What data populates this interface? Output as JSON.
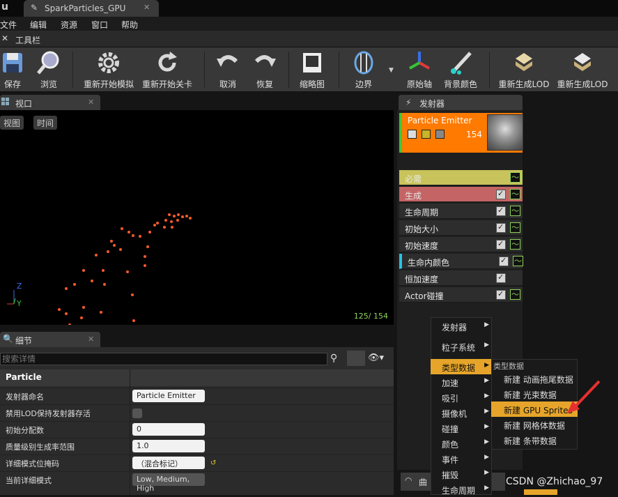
{
  "titlebar": {
    "tab_title": "SparkParticles_GPU",
    "logo_icon": "ue-logo-icon"
  },
  "menu": [
    "文件",
    "编辑",
    "资源",
    "窗口",
    "帮助"
  ],
  "toolbar_header": {
    "label": "工具栏"
  },
  "toolbar": [
    {
      "label": "保存",
      "icon": "save-icon"
    },
    {
      "label": "浏览",
      "icon": "magnifier-icon"
    },
    {
      "label": "重新开始模拟",
      "icon": "gear-restart-icon"
    },
    {
      "label": "重新开始关卡",
      "icon": "refresh-icon"
    },
    {
      "label": "取消",
      "icon": "undo-icon"
    },
    {
      "label": "恢复",
      "icon": "redo-icon"
    },
    {
      "label": "缩略图",
      "icon": "thumbnail-icon"
    },
    {
      "label": "边界",
      "icon": "bounds-icon"
    },
    {
      "label": "原始轴",
      "icon": "axis-icon"
    },
    {
      "label": "背景颜色",
      "icon": "background-color-icon"
    },
    {
      "label": "重新生成LOD",
      "icon": "regen-lod-icon"
    },
    {
      "label": "重新生成LOD",
      "icon": "regen-lod-icon"
    }
  ],
  "viewport": {
    "tab_label": "视口",
    "buttons": [
      "视图",
      "时间"
    ],
    "counter": "125/ 154",
    "axis_labels": {
      "z": "Z",
      "y": "Y"
    }
  },
  "emitter_panel": {
    "tab_label": "发射器",
    "emitter_name": "Particle Emitter",
    "count": "154",
    "modules": [
      {
        "label": "必需",
        "color": "#c8c35a",
        "has_checkbox": false
      },
      {
        "label": "生成",
        "color": "#c46464",
        "has_checkbox": true
      },
      {
        "label": "生命周期",
        "color": "#2d2d2d",
        "has_checkbox": true
      },
      {
        "label": "初始大小",
        "color": "#2d2d2d",
        "has_checkbox": true
      },
      {
        "label": "初始速度",
        "color": "#2d2d2d",
        "has_checkbox": true
      },
      {
        "label": "生命内颜色",
        "color": "#2d2d2d",
        "has_checkbox": true,
        "marker": "#25c4e6"
      },
      {
        "label": "恒加速度",
        "color": "#2d2d2d",
        "has_checkbox": true,
        "no_curve": true
      },
      {
        "label": "Actor碰撞",
        "color": "#2d2d2d",
        "has_checkbox": true
      }
    ]
  },
  "details": {
    "tab_label": "细节",
    "search_placeholder": "搜索详情",
    "category": "Particle",
    "rows": [
      {
        "label": "发射器命名",
        "value": "Particle Emitter"
      },
      {
        "label": "禁用LOD保持发射器存活",
        "value": ""
      },
      {
        "label": "初始分配数",
        "value": "0"
      },
      {
        "label": "质量级别生成率范围",
        "value": "1.0"
      },
      {
        "label": "详细模式位掩码",
        "value": "（混合标记）"
      },
      {
        "label": "当前详细模式",
        "value": "Low, Medium, High"
      }
    ]
  },
  "context_menu": {
    "items": [
      "发射器",
      "粒子系统",
      "类型数据",
      "加速",
      "吸引",
      "摄像机",
      "碰撞",
      "颜色",
      "事件",
      "摧毁",
      "生命周期"
    ],
    "active": "类型数据",
    "submenu_title": "类型数据",
    "submenu_items": [
      "新建 动画拖尾数据",
      "新建 光束数据",
      "新建 GPU Sprites",
      "新建 网格体数据",
      "新建 条带数据"
    ],
    "submenu_active": "新建 GPU Sprites"
  },
  "curve_tab": {
    "label": "曲"
  },
  "watermark": "CSDN @Zhichao_97",
  "colors": {
    "accent": "#e6a52a",
    "emitter": "#ff7a00",
    "counter": "#8fd35a"
  }
}
